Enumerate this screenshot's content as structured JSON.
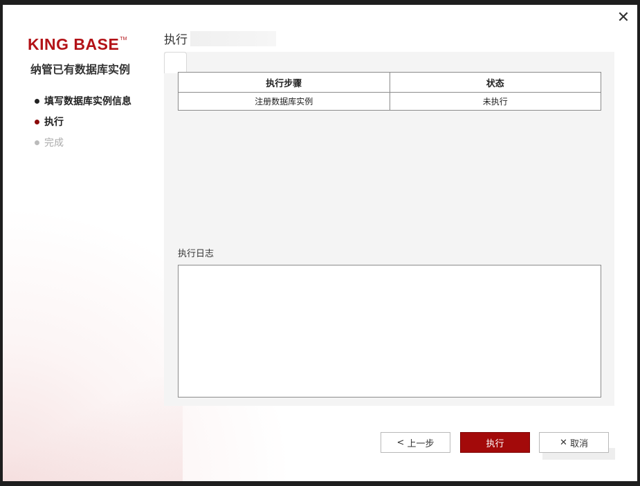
{
  "window": {
    "close_icon": "close-icon"
  },
  "logo": {
    "text": "KING BASE",
    "tm": "TM",
    "color": "#b31217"
  },
  "wizard": {
    "title": "纳管已有数据库实例",
    "steps": [
      {
        "label": "填写数据库实例信息",
        "state": "done"
      },
      {
        "label": "执行",
        "state": "active"
      },
      {
        "label": "完成",
        "state": "pending"
      }
    ]
  },
  "main": {
    "title": "执行",
    "table": {
      "headers": [
        "执行步骤",
        "状态"
      ],
      "rows": [
        [
          "注册数据库实例",
          "未执行"
        ]
      ]
    },
    "log_label": "执行日志",
    "log_text": ""
  },
  "buttons": {
    "prev": {
      "label": "上一步",
      "icon": "chevron-left-icon"
    },
    "execute": {
      "label": "执行"
    },
    "cancel": {
      "label": "取消",
      "icon": "close-icon"
    }
  },
  "colors": {
    "accent": "#a30a0a",
    "active_step_dot": "#8b0a0a"
  }
}
